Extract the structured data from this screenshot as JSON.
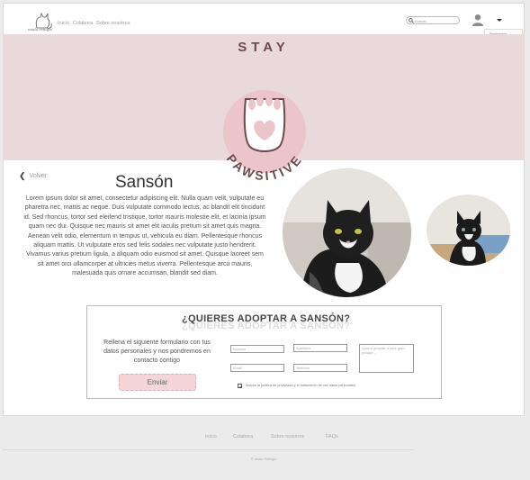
{
  "header": {
    "logo_text": "mialo refugio",
    "nav": [
      "Inicio",
      "Colabora",
      "Sobre nosotros"
    ],
    "search_placeholder": "Buscar...",
    "dropdown": [
      "Registrarse",
      "Iniciar sesión"
    ]
  },
  "banner": {
    "top_text": "STAY",
    "bottom_text": "PAWSITIVE",
    "colors": {
      "background": "#ead9db",
      "badge": "#ebc5c9",
      "accent": "#6d4a4d"
    }
  },
  "profile": {
    "back_label": "Volver",
    "name": "Sansón",
    "description": "Lorem ipsum dolor sit amet, consectetur adipiscing elit. Nulla quam velit, vulputate eu pharetra nec, mattis ac neque. Duis vulputate commodo lectus, ac blandit elit tincidunt id. Sed rhoncus, tortor sed eleifend tristique, tortor mauris molestie elit, et lacinia ipsum quam nec dui. Quisque nec mauris sit amet elit iaculis pretium sit amet quis magna. Aenean velit odio, elementum in tempus ut, vehicula eu diam. Pellentesque rhoncus aliquam mattis. Ut vulputate eros sed felis sodales nec vulputate justo hendrerit. Vivamus varius pretium ligula, a aliquam odio euismod sit amet. Quisque laoreet sem sit amet orci ullamcorper at ultricies metus viverra. Pellentesque arcu mauris, malesuada quis ornare accumsan, blandit sed diam."
  },
  "form": {
    "title": "¿QUIERES ADOPTAR A SANSÓN?",
    "intro": "Rellena el siguiente formulario con tus datos personales y nos pondremos en contacto contigo",
    "send_label": "Enviar",
    "fields": {
      "nombre": "Nombre",
      "apellidos": "Apellidos",
      "email": "Email",
      "telefono": "Teléfono",
      "message": "Quiero adoptar a este gato porque..."
    },
    "privacy": "Acepto la política de privacidad y el tratamiento de mis datos personales"
  },
  "footer": {
    "nav": [
      "Inicio",
      "Colabora",
      "Sobre nosotros",
      "FAQs"
    ],
    "copyright": "© mialo Refugio"
  }
}
